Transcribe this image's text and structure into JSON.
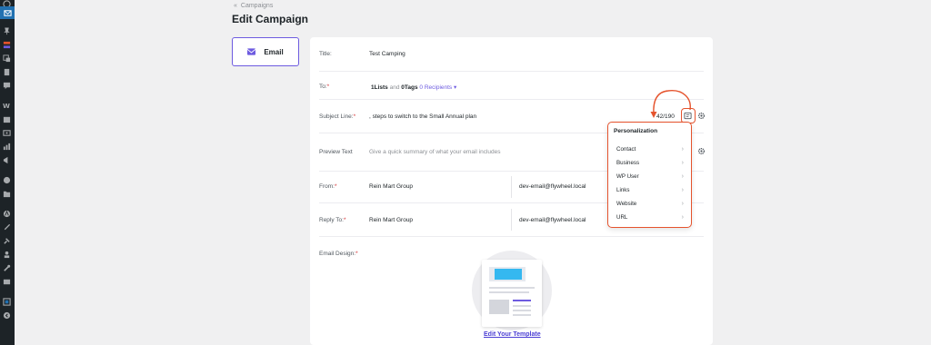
{
  "breadcrumb": {
    "text": "Campaigns"
  },
  "page": {
    "title": "Edit Campaign"
  },
  "tabs": [
    {
      "label": "Email",
      "icon": "envelope-icon"
    }
  ],
  "form": {
    "title": {
      "label": "Title:",
      "value": "Test Camping"
    },
    "to": {
      "label": "To:",
      "required": "*",
      "lists": "1Lists",
      "and": "and",
      "tags": "0Tags",
      "recipients": "0 Recipients"
    },
    "subject": {
      "label": "Subject Line:",
      "required": "*",
      "value": ", steps to switch to the Small Annual plan",
      "counter": "42/190"
    },
    "preview": {
      "label": "Preview Text",
      "placeholder": "Give a quick summary of what your email includes"
    },
    "from": {
      "label": "From:",
      "required": "*",
      "name": "Rein Mart Group",
      "email": "dev-email@flywheel.local"
    },
    "reply_to": {
      "label": "Reply To:",
      "required": "*",
      "name": "Rein Mart Group",
      "email": "dev-email@flywheel.local"
    },
    "design": {
      "label": "Email Design:",
      "required": "*",
      "link": "Edit Your Template"
    }
  },
  "personalization": {
    "title": "Personalization",
    "items": [
      "Contact",
      "Business",
      "WP User",
      "Links",
      "Website",
      "URL"
    ]
  },
  "colors": {
    "accent": "#6d5be0",
    "highlight": "#e5532d",
    "wp_sidebar": "#1d2327",
    "wp_active": "#2271b1"
  }
}
